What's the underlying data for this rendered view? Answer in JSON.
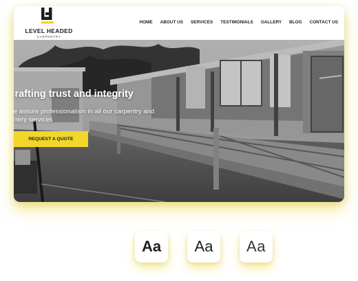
{
  "site": {
    "logo": {
      "name": "LEVEL HEADED",
      "tagline": "CARPENTRY",
      "icon": "lh-monogram-icon"
    },
    "nav": {
      "items": [
        "HOME",
        "ABOUT US",
        "SERVICES",
        "TESTIMONIALS",
        "GALLERY",
        "BLOG",
        "CONTACT US"
      ]
    },
    "hero": {
      "title": "Crafting trust and integrity",
      "subtitle": "We assure professionalism in all our carpentry and joinery services",
      "cta": "REQUEST A QUOTE",
      "image": "grayscale-construction-deck-photo"
    }
  },
  "font_samples": [
    "Aa",
    "Aa",
    "Aa"
  ],
  "colors": {
    "accent": "#f2d62a",
    "text": "#1d1d1d"
  }
}
